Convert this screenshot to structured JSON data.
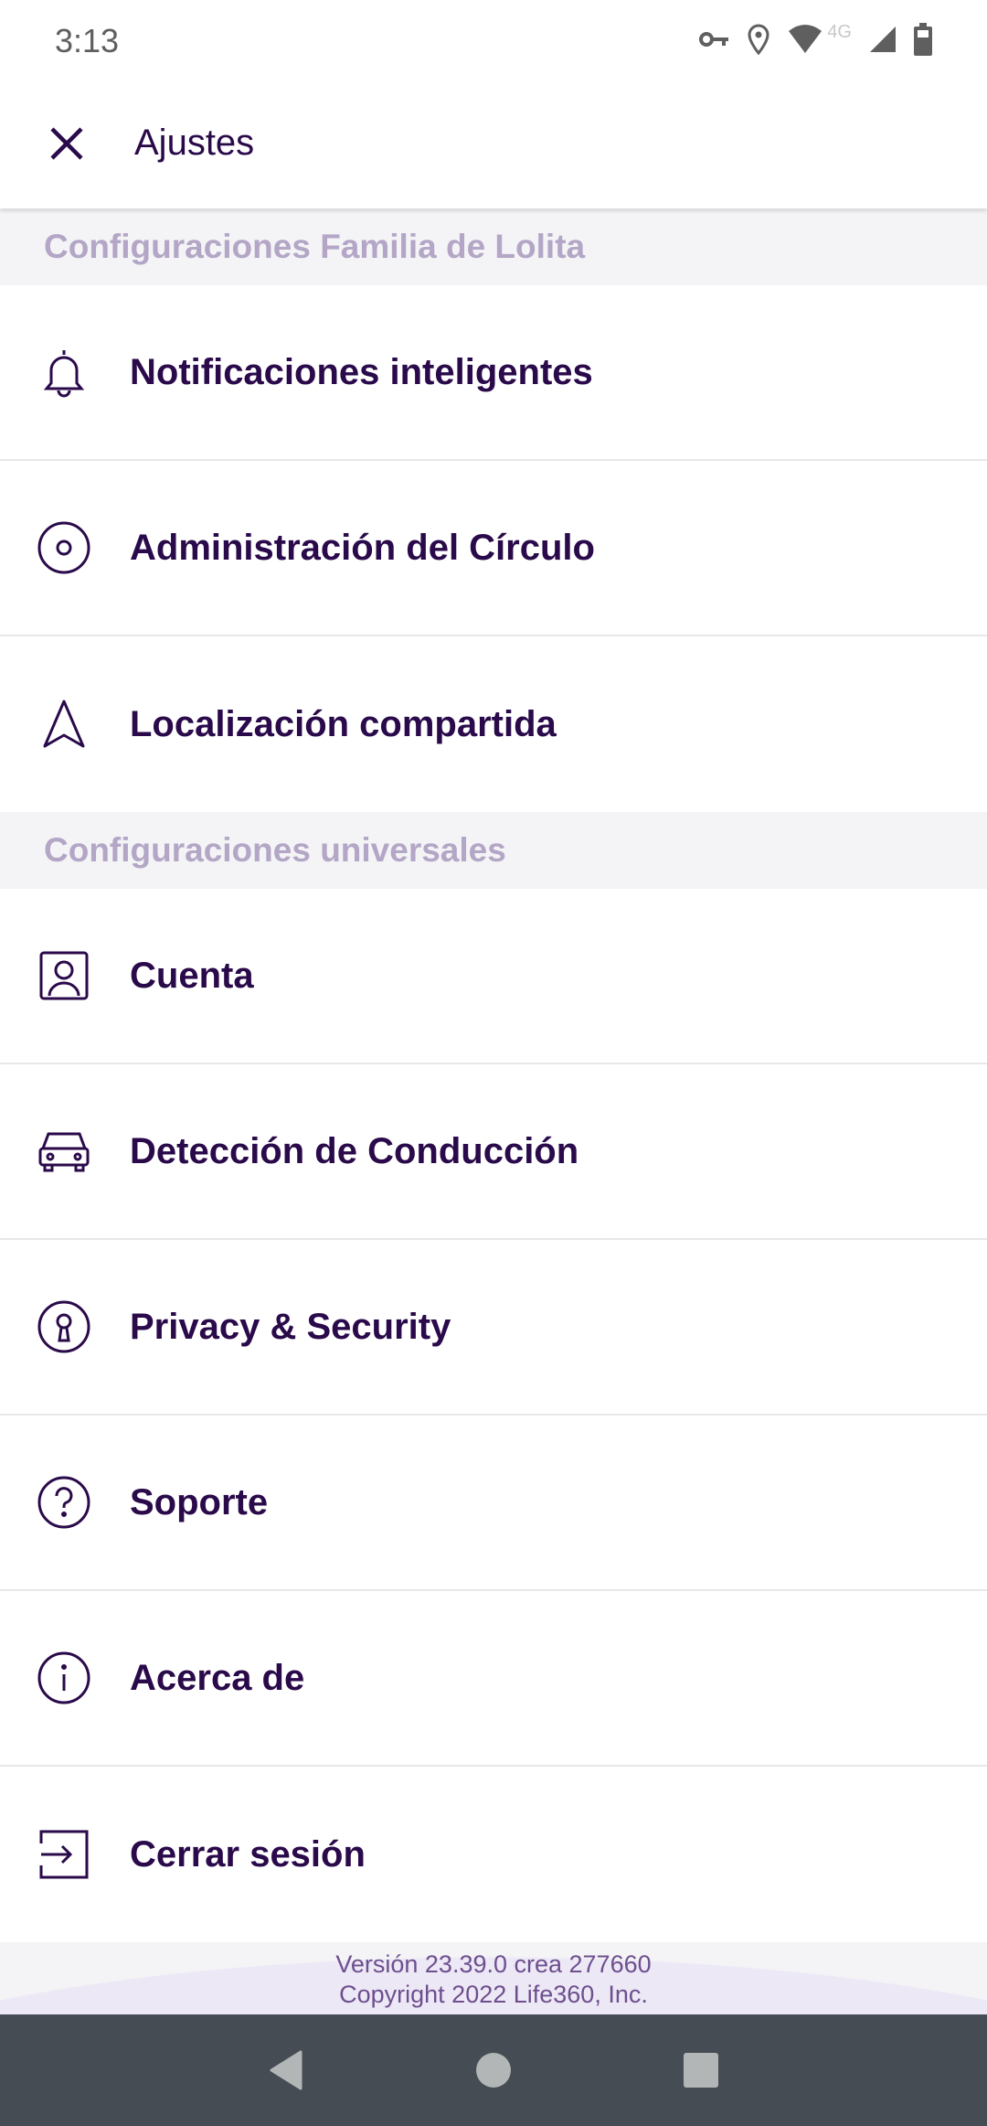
{
  "status_bar": {
    "time": "3:13",
    "network": "4G"
  },
  "header": {
    "title": "Ajustes"
  },
  "sections": [
    {
      "title": "Configuraciones Familia de Lolita",
      "items": [
        {
          "label": "Notificaciones inteligentes",
          "icon": "bell-icon"
        },
        {
          "label": "Administración del Círculo",
          "icon": "circle-icon"
        },
        {
          "label": "Localización compartida",
          "icon": "navigation-arrow-icon"
        }
      ]
    },
    {
      "title": "Configuraciones universales",
      "items": [
        {
          "label": "Cuenta",
          "icon": "account-icon"
        },
        {
          "label": "Detección de Conducción",
          "icon": "car-icon"
        },
        {
          "label": "Privacy & Security",
          "icon": "keyhole-icon"
        },
        {
          "label": "Soporte",
          "icon": "help-icon"
        },
        {
          "label": "Acerca de",
          "icon": "info-icon"
        },
        {
          "label": "Cerrar sesión",
          "icon": "logout-icon"
        }
      ]
    }
  ],
  "footer": {
    "version": "Versión 23.39.0 crea 277660",
    "copyright": "Copyright 2022 Life360, Inc."
  },
  "colors": {
    "primary": "#2a0a4a",
    "section_text": "#b3a6c6",
    "footer_text": "#6e4f8e"
  }
}
